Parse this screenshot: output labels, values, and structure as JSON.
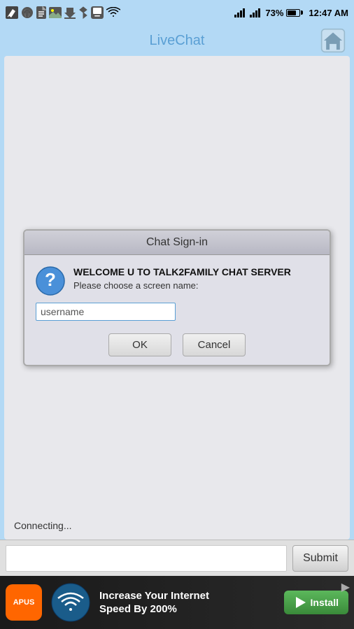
{
  "statusBar": {
    "time": "12:47 AM",
    "battery": "73%",
    "icons": [
      "edit-icon",
      "headset-icon",
      "file-icon",
      "image-icon",
      "download-icon",
      "bluetooth-icon",
      "phone-icon",
      "wifi-icon",
      "signal-icon",
      "battery-icon"
    ]
  },
  "topBar": {
    "title": "LiveChat",
    "homeButton": "home-icon"
  },
  "dialog": {
    "title": "Chat Sign-in",
    "welcomeText": "WELCOME U TO TALK2FAMILY CHAT SERVER",
    "chooseText": "Please choose a screen name:",
    "usernameValue": "username",
    "usernamePlaceholder": "username",
    "okLabel": "OK",
    "cancelLabel": "Cancel"
  },
  "footer": {
    "connectingText": "Connecting...",
    "submitLabel": "Submit",
    "messageInputPlaceholder": ""
  },
  "ad": {
    "badgeText": "APUS",
    "titleLine1": "Increase Your Internet",
    "titleLine2": "Speed By 200%",
    "installLabel": "Install"
  }
}
